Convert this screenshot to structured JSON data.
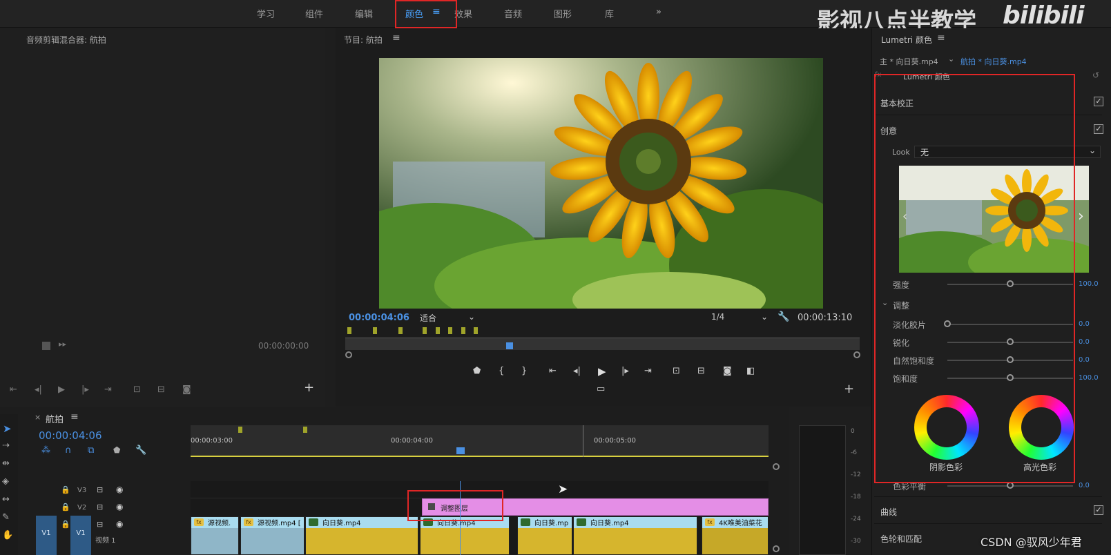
{
  "workspace": {
    "tabs": [
      "学习",
      "组件",
      "编辑",
      "颜色",
      "效果",
      "音频",
      "图形",
      "库"
    ],
    "active_tab": "颜色",
    "overflow": "»"
  },
  "watermark": {
    "channel": "影视八点半教学",
    "site": "bilibili",
    "author": "CSDN @驭风少年君"
  },
  "source_panel": {
    "title": "音频剪辑混合器: 航拍",
    "timecode": "00:00:00:00"
  },
  "program": {
    "title": "节目: 航拍",
    "timecode": "00:00:04:06",
    "fit": "适合",
    "resolution": "1/4",
    "duration": "00:00:13:10",
    "scrub_progress": 0.32
  },
  "timeline": {
    "tab": "航拍",
    "timecode": "00:00:04:06",
    "ruler": [
      "00:00:03:00",
      "00:00:04:00",
      "00:00:05:00"
    ],
    "tracks": [
      {
        "id": "V3"
      },
      {
        "id": "V2"
      },
      {
        "id": "V1",
        "src": "V1",
        "name": "视频 1"
      }
    ],
    "adjustment_clip": "调整图层",
    "clips": [
      {
        "name": "源视频.",
        "fx": true,
        "color": "#8fb6c8"
      },
      {
        "name": "源视频.mp4 [",
        "fx": true,
        "color": "#8fb6c8"
      },
      {
        "name": "向日葵.mp4",
        "fx": false,
        "color": "#d6b52d"
      },
      {
        "name": "向日葵.mp4",
        "fx": false,
        "color": "#d6b52d"
      },
      {
        "name": "向日葵.mp",
        "fx": false,
        "color": "#d6b52d"
      },
      {
        "name": "向日葵.mp4",
        "fx": false,
        "color": "#d6b52d"
      },
      {
        "name": "4K唯美油菜花",
        "fx": true,
        "color": "#c6a828"
      }
    ],
    "meter_scale": [
      "0",
      "-6",
      "-12",
      "-18",
      "-24",
      "-30"
    ]
  },
  "lumetri": {
    "panel_title": "Lumetri 颜色",
    "breadcrumb_master": "主 * 向日葵.mp4",
    "breadcrumb_seq": "航拍 * 向日葵.mp4",
    "effect_name": "Lumetri 颜色",
    "basic": "基本校正",
    "creative": "创意",
    "look_label": "Look",
    "look_value": "无",
    "intensity": {
      "label": "强度",
      "value": "100.0",
      "level": 0.5
    },
    "adjust": "调整",
    "sliders": [
      {
        "label": "淡化胶片",
        "value": "0.0",
        "level": 0.0
      },
      {
        "label": "锐化",
        "value": "0.0",
        "level": 0.5
      },
      {
        "label": "自然饱和度",
        "value": "0.0",
        "level": 0.5
      },
      {
        "label": "饱和度",
        "value": "100.0",
        "level": 0.5
      }
    ],
    "shadow_tint": "阴影色彩",
    "highlight_tint": "高光色彩",
    "balance": {
      "label": "色彩平衡",
      "value": "0.0",
      "level": 0.5
    },
    "curves": "曲线",
    "wheels": "色轮和匹配"
  }
}
